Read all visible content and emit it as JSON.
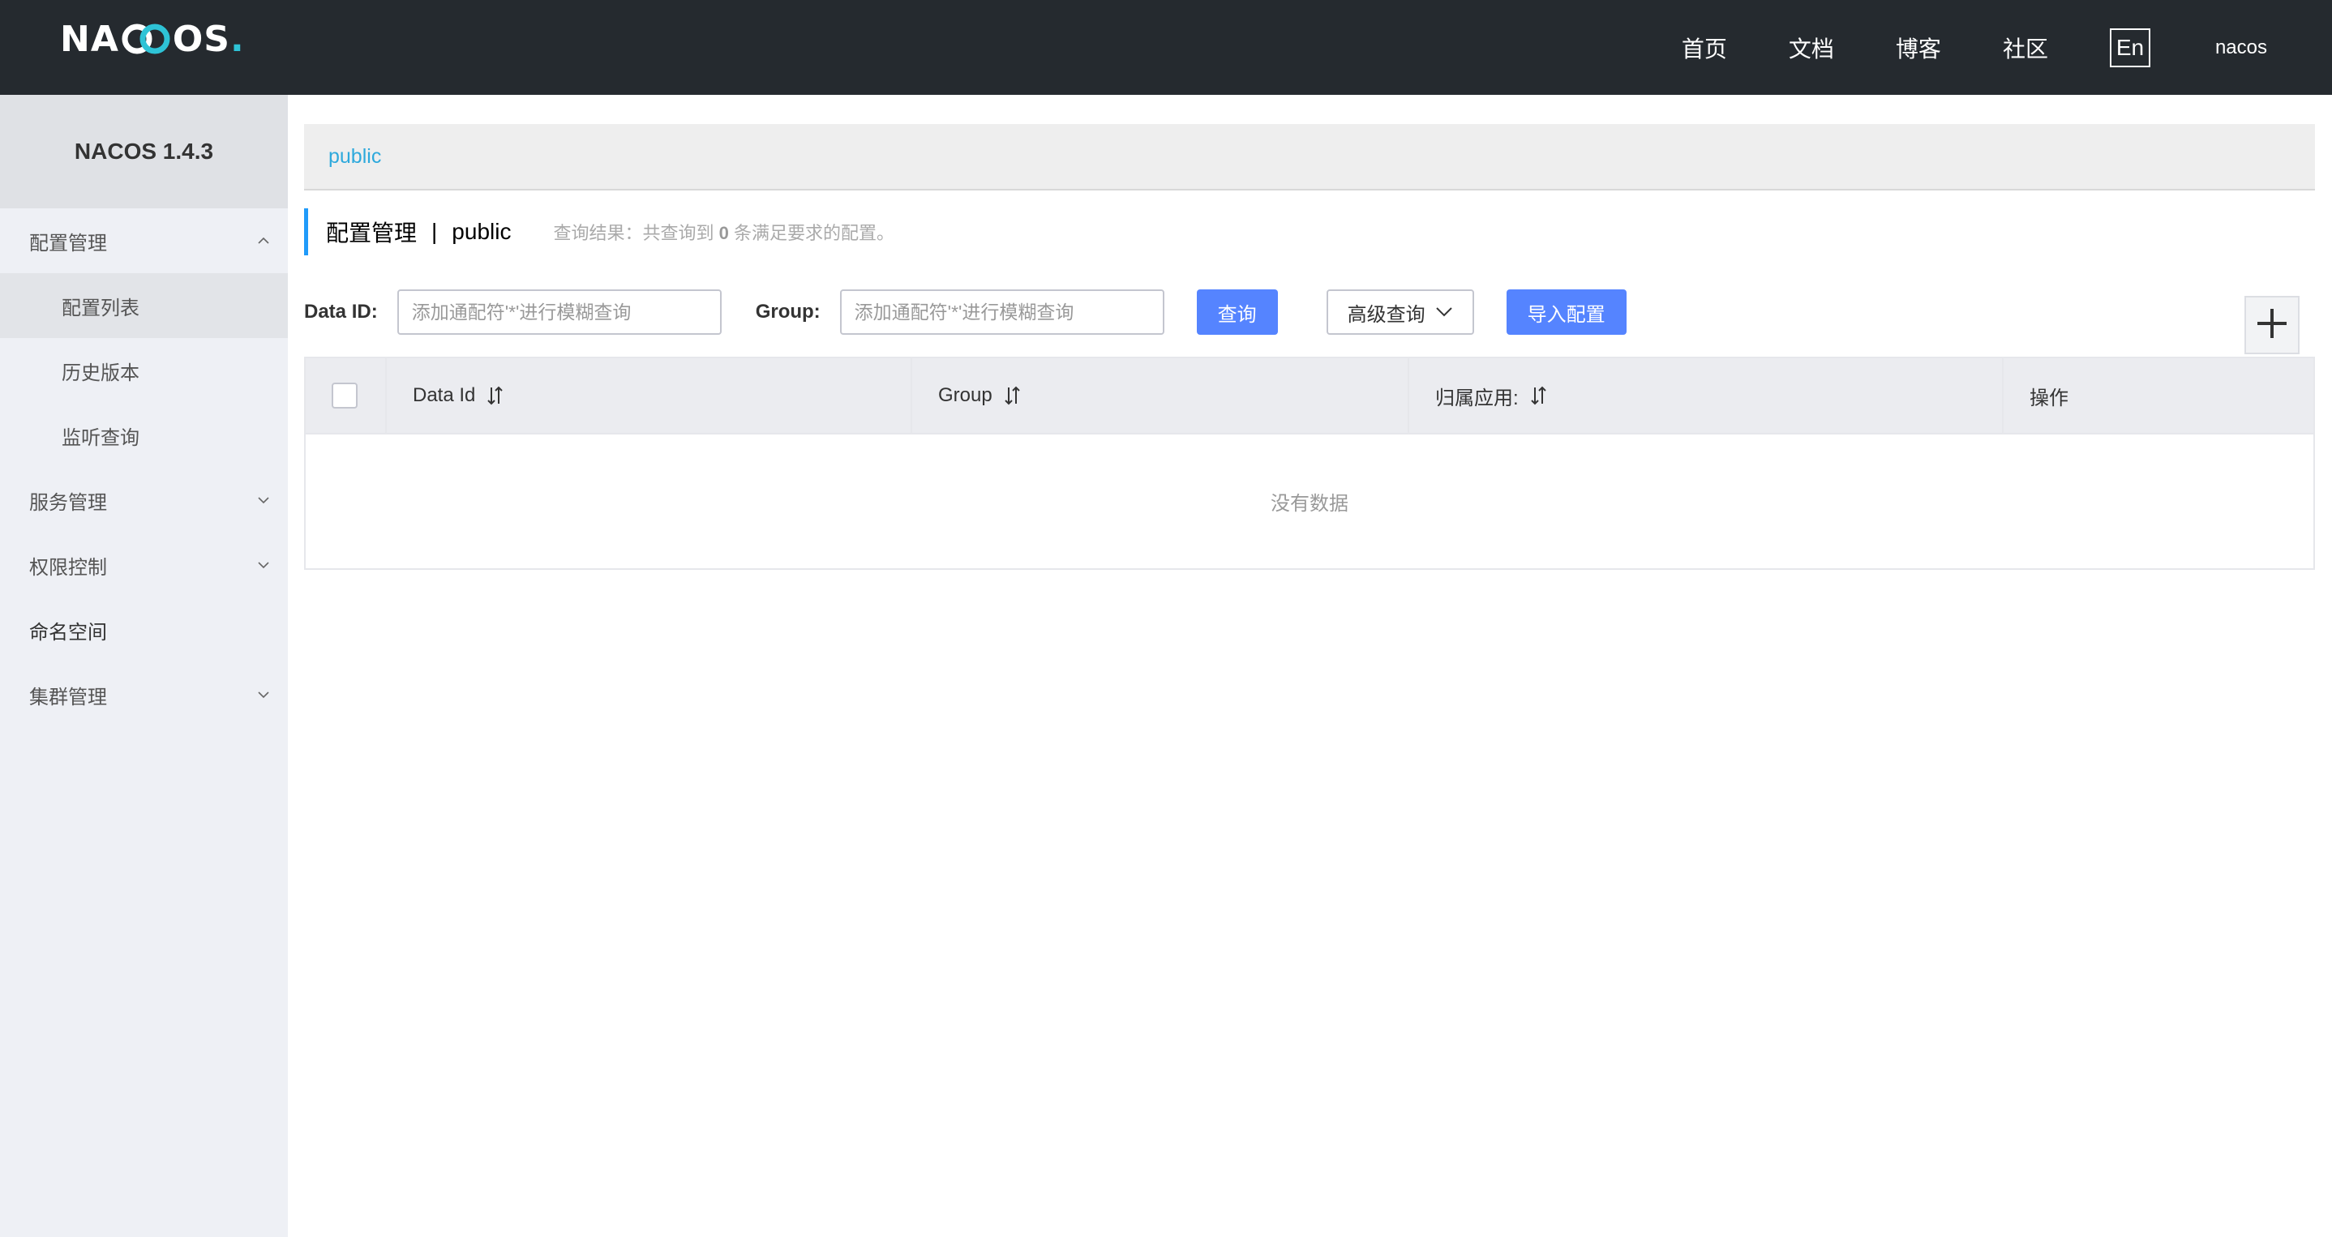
{
  "header": {
    "logo_main": "NA",
    "logo_mid": "OS",
    "logo_dot": ".",
    "nav": [
      "首页",
      "文档",
      "博客",
      "社区"
    ],
    "lang_button": "En",
    "username": "nacos"
  },
  "sidebar": {
    "title": "NACOS 1.4.3",
    "items": [
      {
        "label": "配置管理",
        "expanded": true
      },
      {
        "label": "配置列表",
        "selected": true
      },
      {
        "label": "历史版本"
      },
      {
        "label": "监听查询"
      },
      {
        "label": "服务管理",
        "expanded": false
      },
      {
        "label": "权限控制",
        "expanded": false
      },
      {
        "label": "命名空间"
      },
      {
        "label": "集群管理",
        "expanded": false
      }
    ]
  },
  "main": {
    "namespace_tab": "public",
    "page_title": "配置管理",
    "title_separator": "|",
    "namespace_name": "public",
    "result_prefix": "查询结果：共查询到",
    "result_count": "0",
    "result_suffix": "条满足要求的配置。",
    "search": {
      "data_id_label": "Data ID:",
      "data_id_placeholder": "添加通配符'*'进行模糊查询",
      "group_label": "Group:",
      "group_placeholder": "添加通配符'*'进行模糊查询",
      "query_button": "查询",
      "advanced_button": "高级查询",
      "import_button": "导入配置"
    },
    "table": {
      "columns": [
        "Data Id",
        "Group",
        "归属应用:",
        "操作"
      ],
      "empty_text": "没有数据"
    }
  },
  "colors": {
    "header_bg": "#252a2f",
    "accent": "#5584ff",
    "link": "#2ea9dc",
    "sidebar_bg": "#eef0f5"
  }
}
